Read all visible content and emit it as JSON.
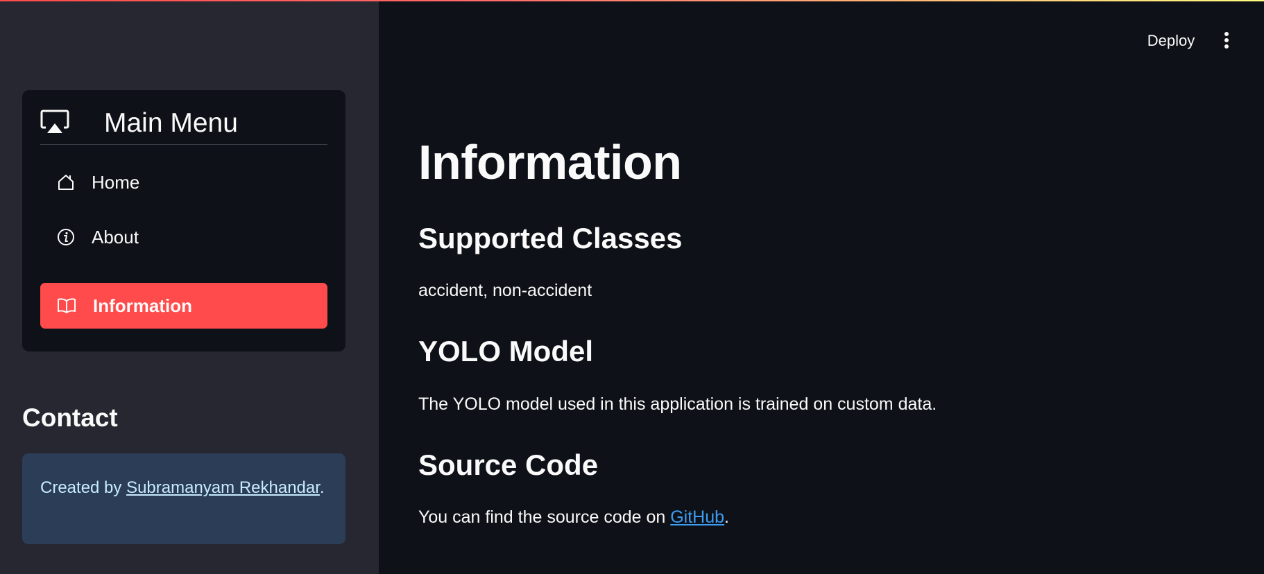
{
  "header": {
    "deploy_label": "Deploy",
    "more_icon": "vertical-dots-icon"
  },
  "sidebar": {
    "menu_title": "Main Menu",
    "menu_icon": "airplay-icon",
    "items": [
      {
        "label": "Home",
        "icon": "house-icon",
        "active": false
      },
      {
        "label": "About",
        "icon": "info-circle-icon",
        "active": false
      },
      {
        "label": "Information",
        "icon": "book-icon",
        "active": true
      }
    ],
    "contact_heading": "Contact",
    "contact": {
      "prefix": "Created by ",
      "link_text": "Subramanyam Rekhandar",
      "suffix": "."
    }
  },
  "main": {
    "title": "Information",
    "sections": [
      {
        "heading": "Supported Classes",
        "text": "accident, non-accident"
      },
      {
        "heading": "YOLO Model",
        "text": "The YOLO model used in this application is trained on custom data."
      },
      {
        "heading": "Source Code",
        "text_prefix": "You can find the source code on ",
        "link_text": "GitHub",
        "text_suffix": "."
      }
    ]
  },
  "colors": {
    "background": "#0e1117",
    "sidebar_background": "#262730",
    "accent": "#ff4b4b",
    "info_box": "#2c3e57",
    "link": "#3d9df3"
  }
}
